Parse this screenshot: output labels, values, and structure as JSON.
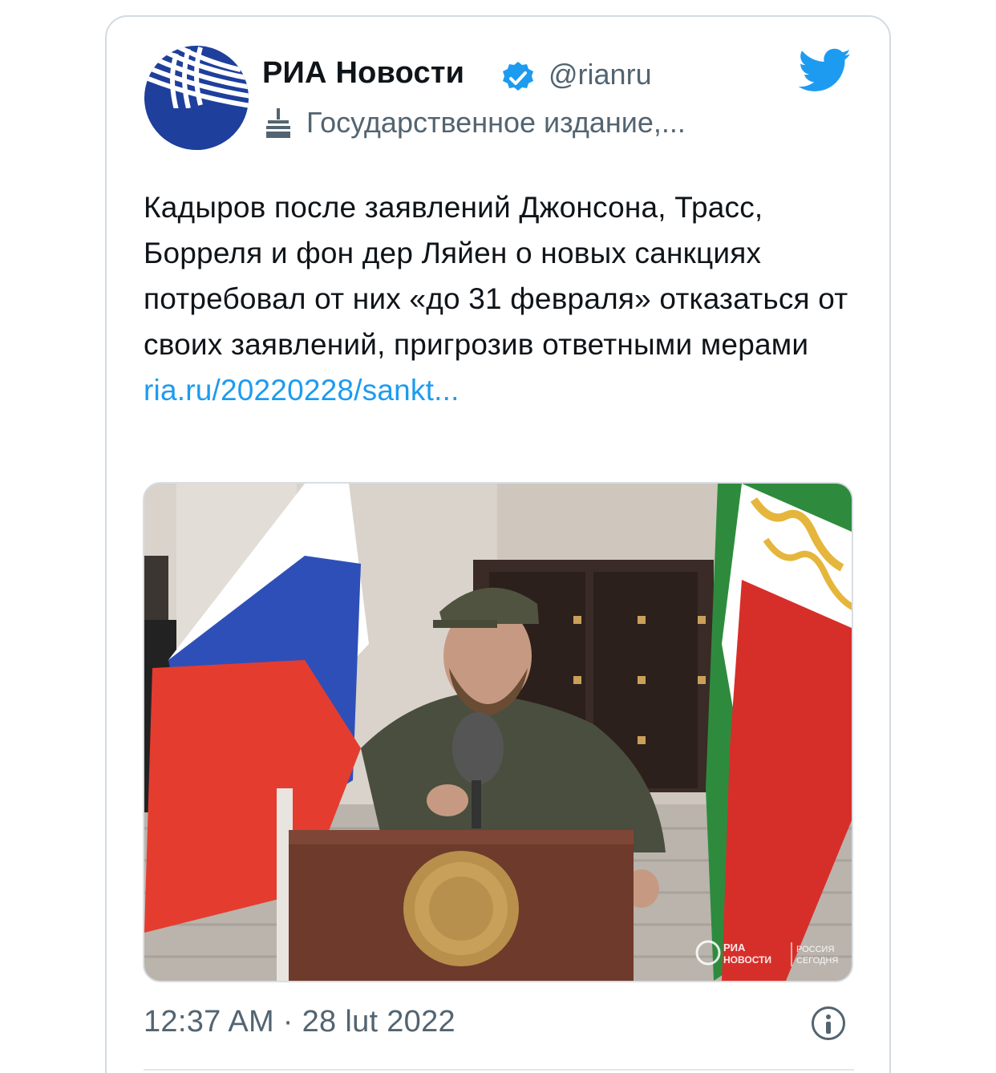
{
  "tweet": {
    "author": {
      "name": "РИА Новости",
      "handle": "@rianru",
      "label": "Государственное издание,...",
      "avatar_icon": "ria-novosti-logo",
      "verified_icon": "verified-badge-icon",
      "label_icon": "government-building-icon"
    },
    "platform_icon": "twitter-bird-icon",
    "text": "Кадыров после заявлений Джонсона, Трасс, Борреля и фон дер Ляйен о новых санкциях потребовал от них «до 31 февраля» отказаться от своих заявлений, пригрозив ответными мерами",
    "link": "ria.ru/20220228/sankt...",
    "media": {
      "watermark_ria_line1": "РИА",
      "watermark_ria_line2": "НОВОСТИ",
      "watermark_rs_line1": "РОССИЯ",
      "watermark_rs_line2": "СЕГОДНЯ"
    },
    "timestamp": "12:37 AM · 28 lut 2022",
    "info_icon": "info-icon"
  },
  "colors": {
    "brand_blue": "#1d9bf0",
    "ria_blue": "#1e3f9c",
    "text_primary": "#0f1419",
    "text_secondary": "#536471"
  }
}
